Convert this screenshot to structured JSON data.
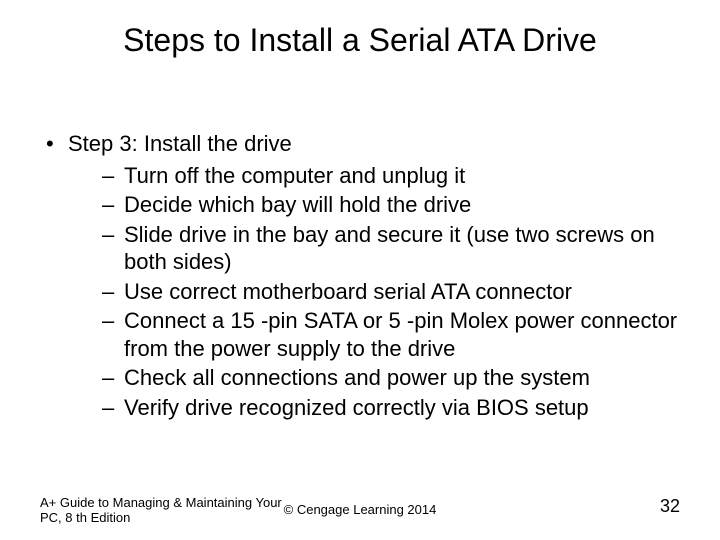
{
  "title": "Steps to Install a Serial ATA Drive",
  "bullet": {
    "text": "Step 3: Install the drive",
    "subitems": [
      "Turn off the computer and unplug it",
      "Decide which bay will hold the drive",
      "Slide drive in the bay and secure it (use two screws on both sides)",
      "Use correct motherboard serial ATA connector",
      "Connect a 15 -pin SATA or 5 -pin Molex power connector from the power supply to the drive",
      "Check all connections and power up the system",
      "Verify drive recognized correctly via BIOS setup"
    ]
  },
  "footer": {
    "left": "A+ Guide to Managing & Maintaining Your PC, 8 th Edition",
    "center": "© Cengage Learning  2014",
    "pageNumber": "32"
  }
}
